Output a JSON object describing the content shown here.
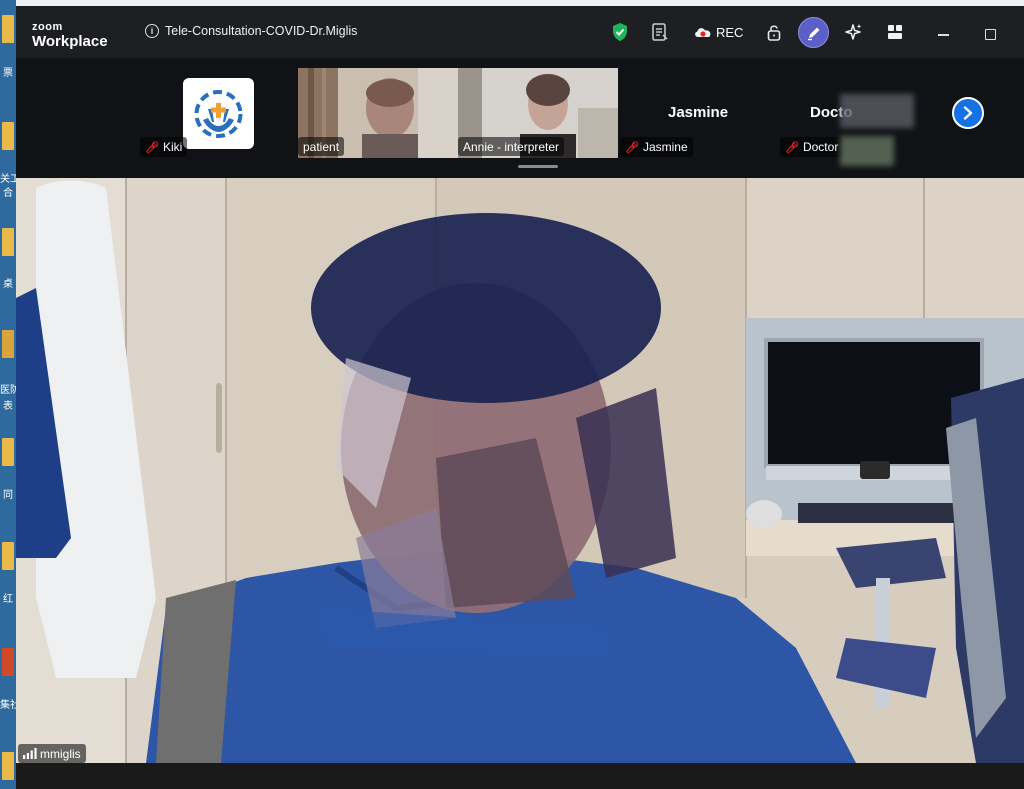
{
  "desktop": {
    "labels": [
      "票",
      "关工",
      "合",
      "桌",
      "医防",
      "表",
      "同",
      "红",
      "集社"
    ]
  },
  "window": {
    "brand_small": "zoom",
    "brand_large": "Workplace",
    "meeting_title": "Tele-Consultation-COVID-Dr.Miglis",
    "rec_label": "REC"
  },
  "gallery": {
    "participants": [
      {
        "name": "Kiki",
        "muted": true,
        "type": "avatar"
      },
      {
        "name": "patient",
        "muted": false,
        "type": "video"
      },
      {
        "name": "Annie - interpreter",
        "muted": false,
        "type": "video"
      },
      {
        "name": "Jasmine",
        "muted": true,
        "type": "name-only",
        "display_name": "Jasmine"
      },
      {
        "name": "Doctor",
        "muted": true,
        "type": "name-only",
        "display_name": "Docto"
      }
    ]
  },
  "main_video": {
    "speaker_name": "mmiglis"
  },
  "colors": {
    "accent_blue": "#1472e6",
    "purple": "#5b5fc7",
    "mute_red": "#e02828",
    "shield_green": "#1fb35a"
  }
}
